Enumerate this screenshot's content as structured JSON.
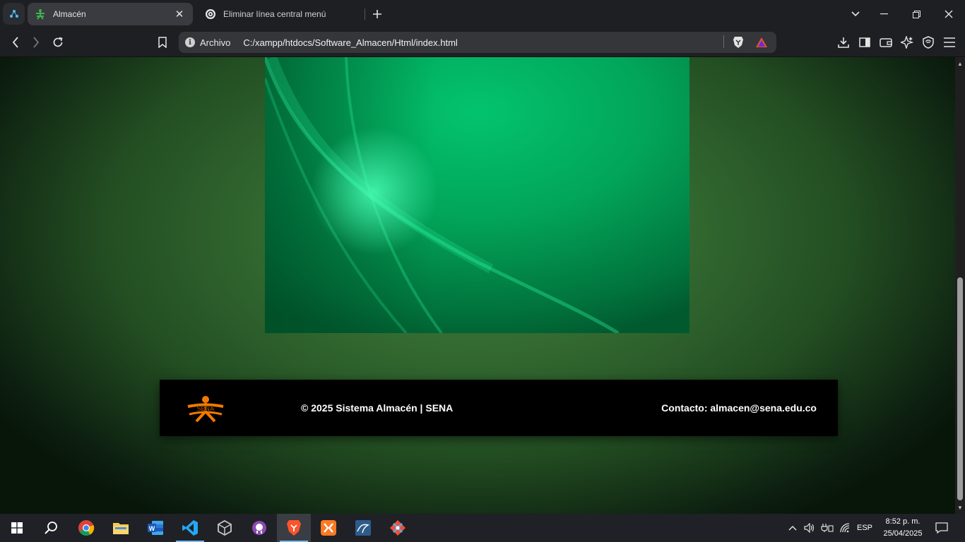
{
  "browser": {
    "tabs": [
      {
        "title": "Almacén",
        "active": true
      },
      {
        "title": "Eliminar línea central menú",
        "active": false
      }
    ],
    "address": {
      "scheme_label": "Archivo",
      "url": "C:/xampp/htdocs/Software_Almacen/Html/index.html"
    }
  },
  "page": {
    "footer": {
      "logo_text": "SENA",
      "copyright": "© 2025 Sistema Almacén | SENA",
      "contact": "Contacto: almacen@sena.edu.co"
    }
  },
  "taskbar": {
    "apps": [
      "start-icon",
      "search-icon",
      "chrome-icon",
      "file-explorer-icon",
      "word-icon",
      "vscode-icon",
      "unity-icon",
      "github-desktop-icon",
      "brave-icon",
      "xampp-icon",
      "mysql-workbench-icon",
      "git-icon"
    ],
    "language": "ESP",
    "time": "8:52 p. m.",
    "date": "25/04/2025"
  },
  "colors": {
    "accent_green": "#03c36e",
    "sena_orange": "#f27a00",
    "footer_bg": "#000000"
  }
}
